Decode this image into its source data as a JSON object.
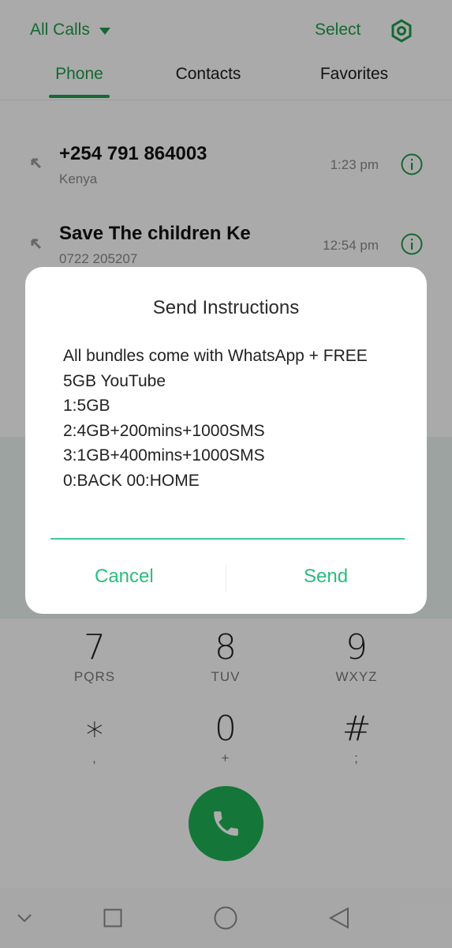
{
  "header": {
    "filter_label": "All Calls",
    "select_label": "Select",
    "tabs": [
      {
        "label": "Phone",
        "active": true
      },
      {
        "label": "Contacts",
        "active": false
      },
      {
        "label": "Favorites",
        "active": false
      }
    ]
  },
  "calls": [
    {
      "name": "+254 791 864003",
      "sub": "Kenya",
      "time": "1:23 pm"
    },
    {
      "name": "Save The children Ke",
      "sub": "0722 205207",
      "time": "12:54 pm"
    }
  ],
  "dialpad": [
    {
      "digit": "7",
      "letters": "PQRS"
    },
    {
      "digit": "8",
      "letters": "TUV"
    },
    {
      "digit": "9",
      "letters": "WXYZ"
    },
    {
      "digit": "∗",
      "letters": ","
    },
    {
      "digit": "0",
      "letters": "+"
    },
    {
      "digit": "#",
      "letters": ";"
    }
  ],
  "dialog": {
    "title": "Send Instructions",
    "lines": [
      "All bundles come with WhatsApp + FREE",
      "5GB YouTube",
      "1:5GB",
      "2:4GB+200mins+1000SMS",
      "3:1GB+400mins+1000SMS",
      "0:BACK 00:HOME"
    ],
    "input_value": "",
    "cancel_label": "Cancel",
    "send_label": "Send"
  },
  "colors": {
    "accent": "#1f9a4a",
    "dialog_accent": "#2bbd7e",
    "call_button": "#1fae55"
  }
}
